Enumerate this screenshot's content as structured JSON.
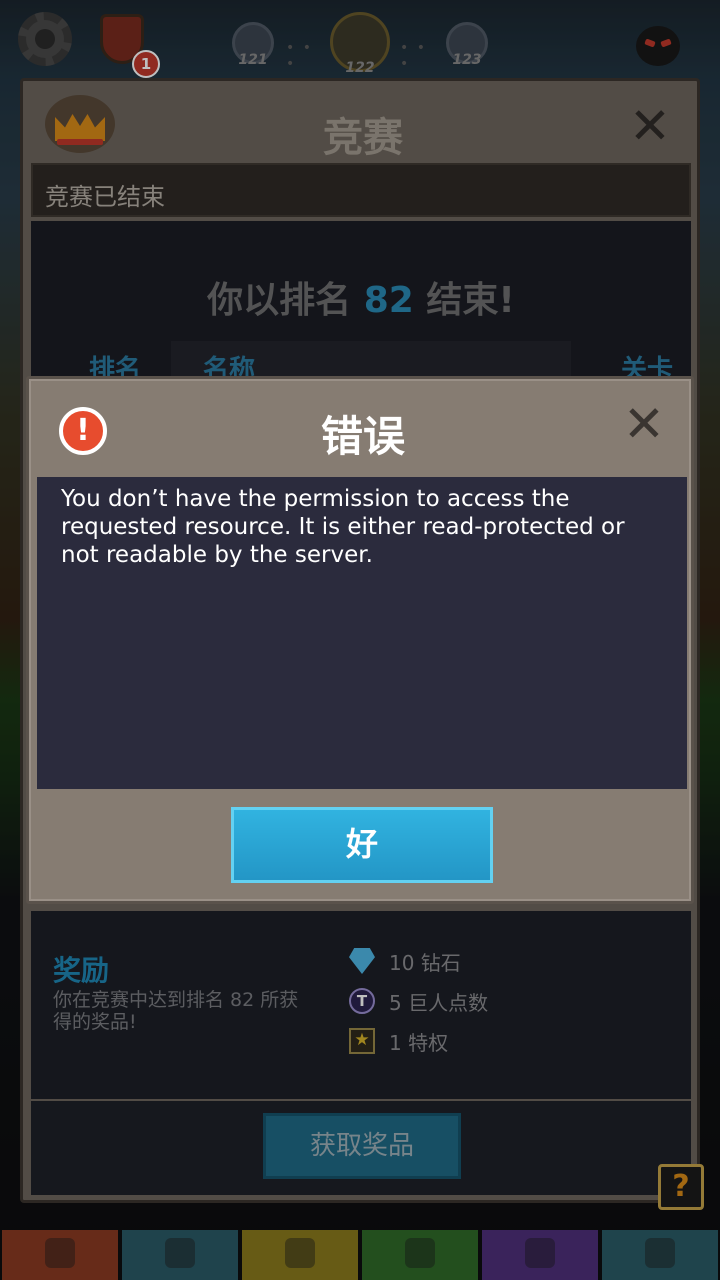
{
  "topbar": {
    "notification_count": "1",
    "levels": [
      "121",
      "122",
      "123"
    ]
  },
  "contest": {
    "title": "竞赛",
    "status": "竞赛已结束",
    "result_prefix": "你以排名",
    "rank": "82",
    "result_suffix": "结束!",
    "columns": [
      "排名",
      "名称",
      "关卡"
    ],
    "reward_title": "奖励",
    "reward_desc": "你在竞赛中达到排名 82 所获得的奖品!",
    "rewards": [
      {
        "icon": "diamond-icon",
        "text": "10 钻石"
      },
      {
        "icon": "titan-points-icon",
        "icon_glyph": "T",
        "text": "5 巨人点数"
      },
      {
        "icon": "perk-star-icon",
        "icon_glyph": "★",
        "text": "1 特权"
      }
    ],
    "claim_label": "获取奖品",
    "help_label": "?"
  },
  "dialog": {
    "title": "错误",
    "icon_glyph": "!",
    "message": "You don’t have the permission to access the requested resource. It is either read-protected or not readable by the server.",
    "ok_label": "好"
  },
  "tabbar": {
    "tabs": [
      {
        "icon": "sword-icon",
        "color": "#8a3a22"
      },
      {
        "icon": "helmet-icon",
        "color": "#2a5a66"
      },
      {
        "icon": "shirt-icon",
        "color": "#8a7a1c"
      },
      {
        "icon": "pet-icon",
        "color": "#2f6a28"
      },
      {
        "icon": "heart-icon",
        "color": "#4e2f7a"
      },
      {
        "icon": "star-icon",
        "color": "#2a5b66"
      }
    ]
  },
  "colors": {
    "accent_blue": "#2a8ab4",
    "error_red": "#e74c2e",
    "ok_button": "#2396c6"
  }
}
